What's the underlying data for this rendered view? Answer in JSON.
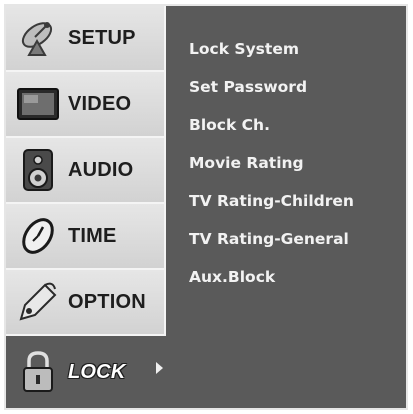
{
  "sidebar": {
    "items": [
      {
        "label": "SETUP",
        "icon": "satellite-dish-icon"
      },
      {
        "label": "VIDEO",
        "icon": "tv-screen-icon"
      },
      {
        "label": "AUDIO",
        "icon": "speaker-icon"
      },
      {
        "label": "TIME",
        "icon": "clock-icon"
      },
      {
        "label": "OPTION",
        "icon": "tag-icon"
      },
      {
        "label": "LOCK",
        "icon": "padlock-icon"
      }
    ],
    "active": "LOCK"
  },
  "menu": {
    "items": [
      "Lock System",
      "Set Password",
      "Block Ch.",
      "Movie Rating",
      "TV Rating-Children",
      "TV Rating-General",
      "Aux.Block"
    ]
  },
  "colors": {
    "panel": "#5a5a5a",
    "sidebar": "#dcdcdc",
    "menu_text": "#f2f2f2",
    "label_text": "#1e1e1e"
  }
}
